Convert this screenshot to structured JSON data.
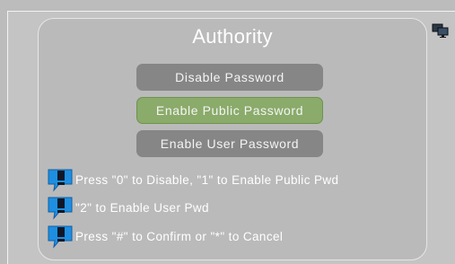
{
  "dialog": {
    "title": "Authority"
  },
  "buttons": {
    "disable": "Disable Password",
    "public": "Enable Public Password",
    "user": "Enable User  Password"
  },
  "hints": [
    {
      "icon": "speech-exclamation-icon",
      "text": "Press \"0\" to Disable, \"1\" to Enable Public Pwd"
    },
    {
      "icon": "speech-exclamation-icon",
      "text": "\"2\" to Enable User Pwd"
    },
    {
      "icon": "speech-exclamation-icon",
      "text": "Press \"#\" to Confirm or \"*\" to Cancel"
    }
  ],
  "corner_icon": "dual-monitor-icon",
  "colors": {
    "background": "#bcbcbc",
    "button_default": "#868686",
    "button_selected": "#8aab6a",
    "hint_icon": "#1e8fe0"
  }
}
